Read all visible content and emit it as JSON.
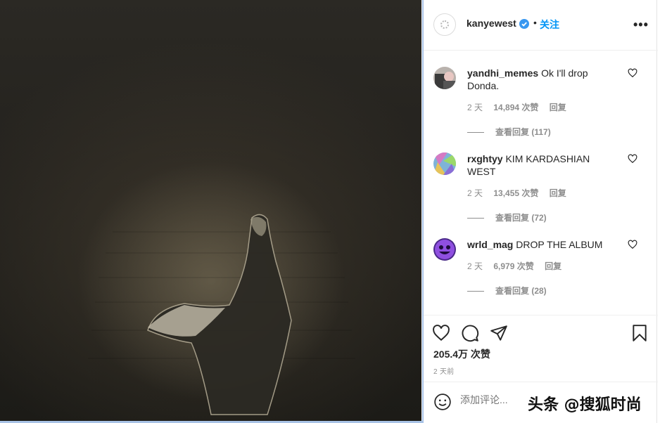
{
  "post": {
    "image_icon": "veiled-figure-photo"
  },
  "header": {
    "username": "kanyewest",
    "verified_icon": "verified-badge-icon",
    "separator": "•",
    "follow_label": "关注",
    "more_label": "•••"
  },
  "comments": [
    {
      "username": "yandhi_memes",
      "text": "Ok I'll drop Donda.",
      "time": "2 天",
      "likes": "14,894 次赞",
      "reply": "回复",
      "view_replies": "查看回复 (117)"
    },
    {
      "username": "rxghtyy",
      "text": "KIM KARDASHIAN WEST",
      "time": "2 天",
      "likes": "13,455 次赞",
      "reply": "回复",
      "view_replies": "查看回复 (72)"
    },
    {
      "username": "wrld_mag",
      "text": "DROP THE ALBUM",
      "time": "2 天",
      "likes": "6,979 次赞",
      "reply": "回复",
      "view_replies": "查看回复 (28)"
    }
  ],
  "actions": {
    "likes_total": "205.4万 次赞",
    "time_ago": "2 天前"
  },
  "comment_box": {
    "placeholder": "添加评论...",
    "watermark": "头条 @搜狐时尚"
  },
  "colors": {
    "accent": "#0095f6",
    "verified": "#3897f0",
    "panel_border": "#a9c3e6"
  }
}
